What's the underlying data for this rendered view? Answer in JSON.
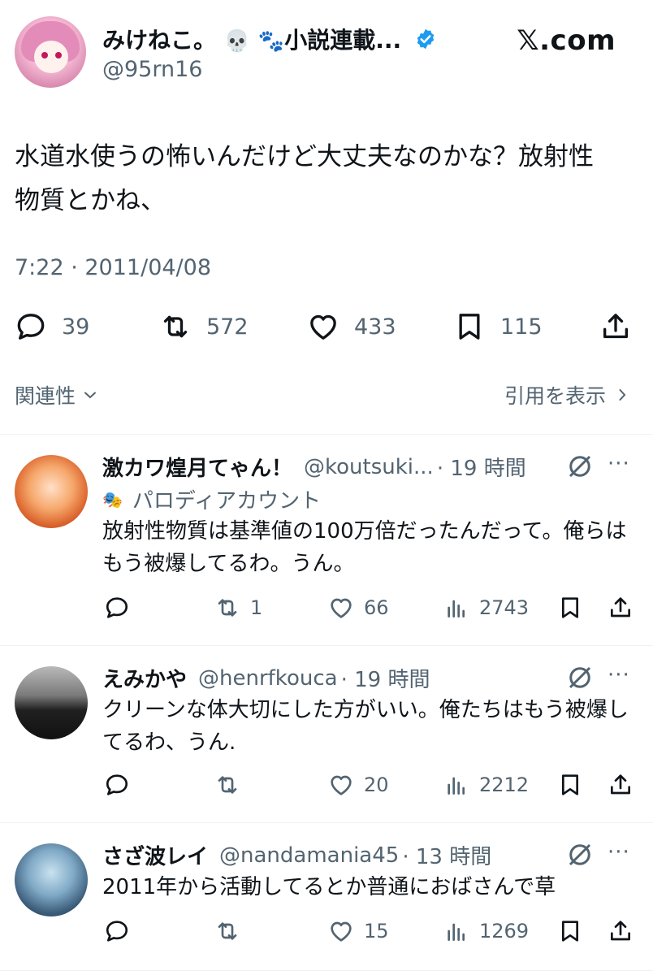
{
  "tweet": {
    "display_name": "みけねこ。",
    "name_suffix": "小説連載...",
    "handle": "@95rn16",
    "site_label": "𝕏.com",
    "text_line1": "水道水使うの怖いんだけど大丈夫なのかな？放射性",
    "text_line2": "物質とかね、",
    "timestamp": "7:22 · 2011/04/08",
    "replies": "39",
    "retweets": "572",
    "likes": "433",
    "bookmarks": "115"
  },
  "filters": {
    "relevance_label": "関連性",
    "quotes_label": "引用を表示"
  },
  "colors": {
    "text": "#0f1419",
    "secondary": "#536471",
    "verified": "#1d9bf0",
    "divider": "#eff3f4"
  },
  "replies": [
    {
      "name": "激カワ煌月てゃん！",
      "handle": "@koutsuki...",
      "time": "· 19 時間",
      "badge": "パロディアカウント",
      "text": "放射性物質は基準値の100万倍だったんだって。俺らはもう被爆してるわ。うん。",
      "replies": "",
      "retweets": "1",
      "likes": "66",
      "views": "2743"
    },
    {
      "name": "えみかや",
      "handle": "@henrfkouca",
      "time": "· 19 時間",
      "text": "クリーンな体大切にした方がいい。俺たちはもう被爆してるわ、うん.",
      "replies": "",
      "retweets": "",
      "likes": "20",
      "views": "2212"
    },
    {
      "name": "さざ波レイ",
      "handle": "@nandamania45",
      "time": "· 13 時間",
      "text": "2011年から活動してるとか普通におばさんで草",
      "replies": "",
      "retweets": "",
      "likes": "15",
      "views": "1269"
    }
  ]
}
